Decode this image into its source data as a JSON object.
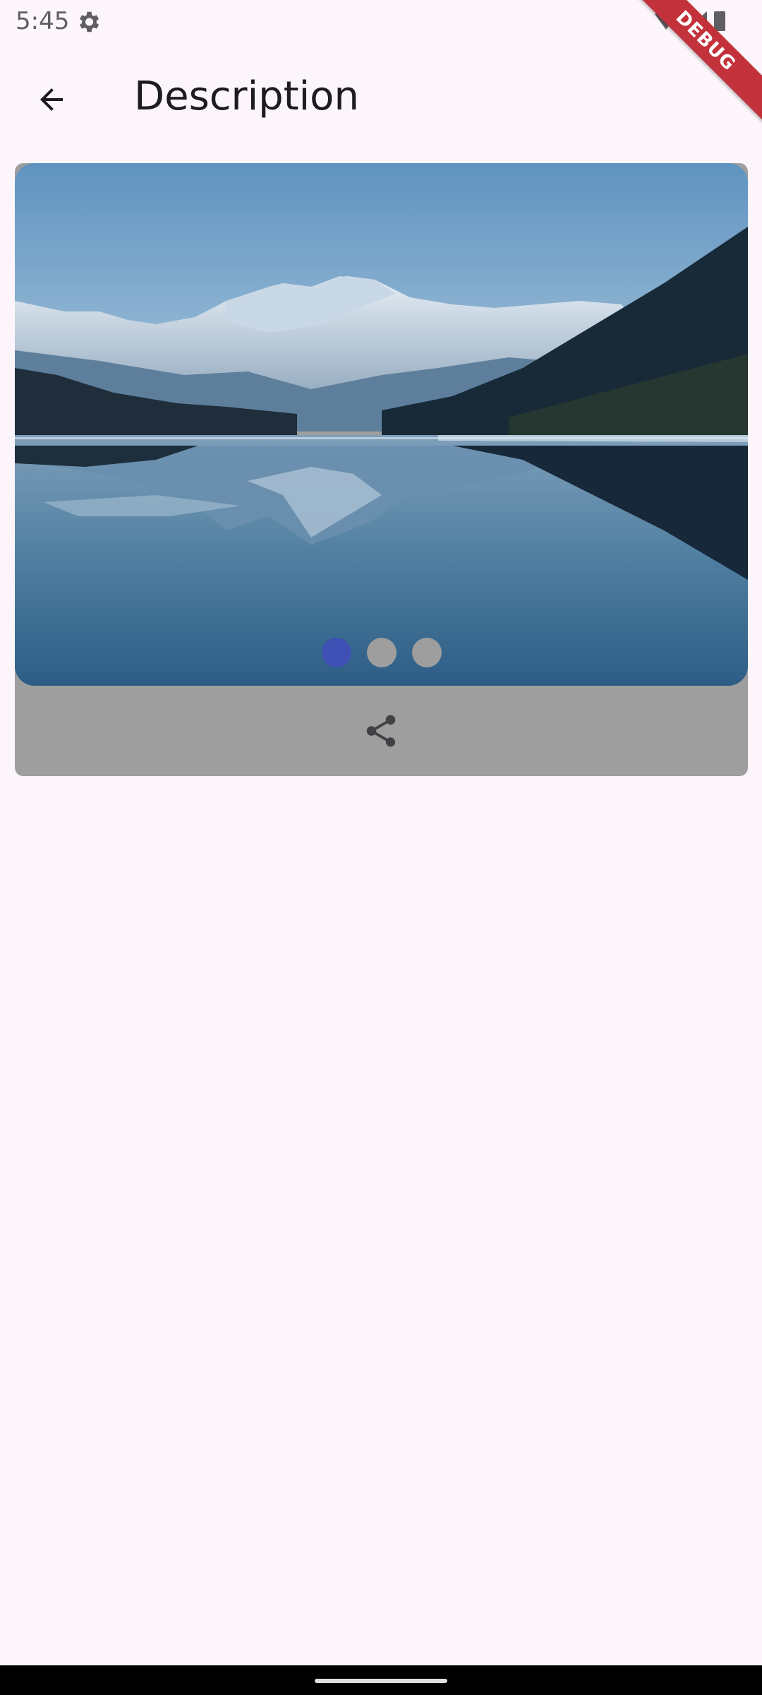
{
  "status_bar": {
    "time": "5:45",
    "icons": [
      "gear-icon",
      "wifi-icon",
      "signal-icon",
      "battery-icon"
    ]
  },
  "debug_banner": {
    "label": "DEBUG",
    "color": "#c3323a"
  },
  "app_bar": {
    "back_icon": "arrow-back-icon",
    "title": "Description"
  },
  "carousel": {
    "image": "mountain-lake-landscape",
    "page_count": 3,
    "active_index": 0,
    "active_color": "#3f51b5",
    "inactive_color": "#9e9e9e"
  },
  "actions": {
    "share_icon": "share-icon"
  },
  "colors": {
    "background": "#fdf5fc",
    "card": "#9e9e9e"
  }
}
